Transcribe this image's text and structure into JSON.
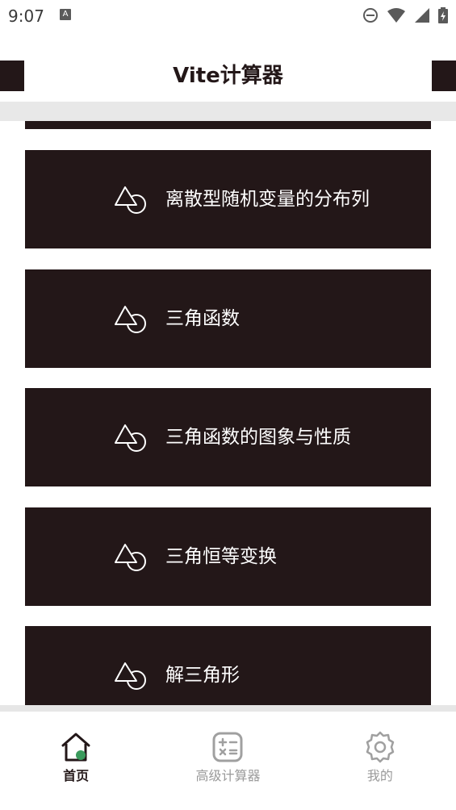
{
  "status_bar": {
    "time": "9:07",
    "notification_icon": "A"
  },
  "header": {
    "title": "Vite计算器"
  },
  "list": {
    "icon": "triangle-circle-icon",
    "items": [
      {
        "label": "离散型随机变量的分布列"
      },
      {
        "label": "三角函数"
      },
      {
        "label": "三角函数的图象与性质"
      },
      {
        "label": "三角恒等变换"
      },
      {
        "label": "解三角形"
      }
    ]
  },
  "bottom_nav": {
    "items": [
      {
        "label": "首页",
        "icon": "home-icon",
        "active": true
      },
      {
        "label": "高级计算器",
        "icon": "calculator-icon",
        "active": false
      },
      {
        "label": "我的",
        "icon": "gear-icon",
        "active": false
      }
    ]
  },
  "colors": {
    "card_bg": "#231718",
    "accent_green": "#3a9a5c",
    "inactive": "#9a9a9a"
  }
}
